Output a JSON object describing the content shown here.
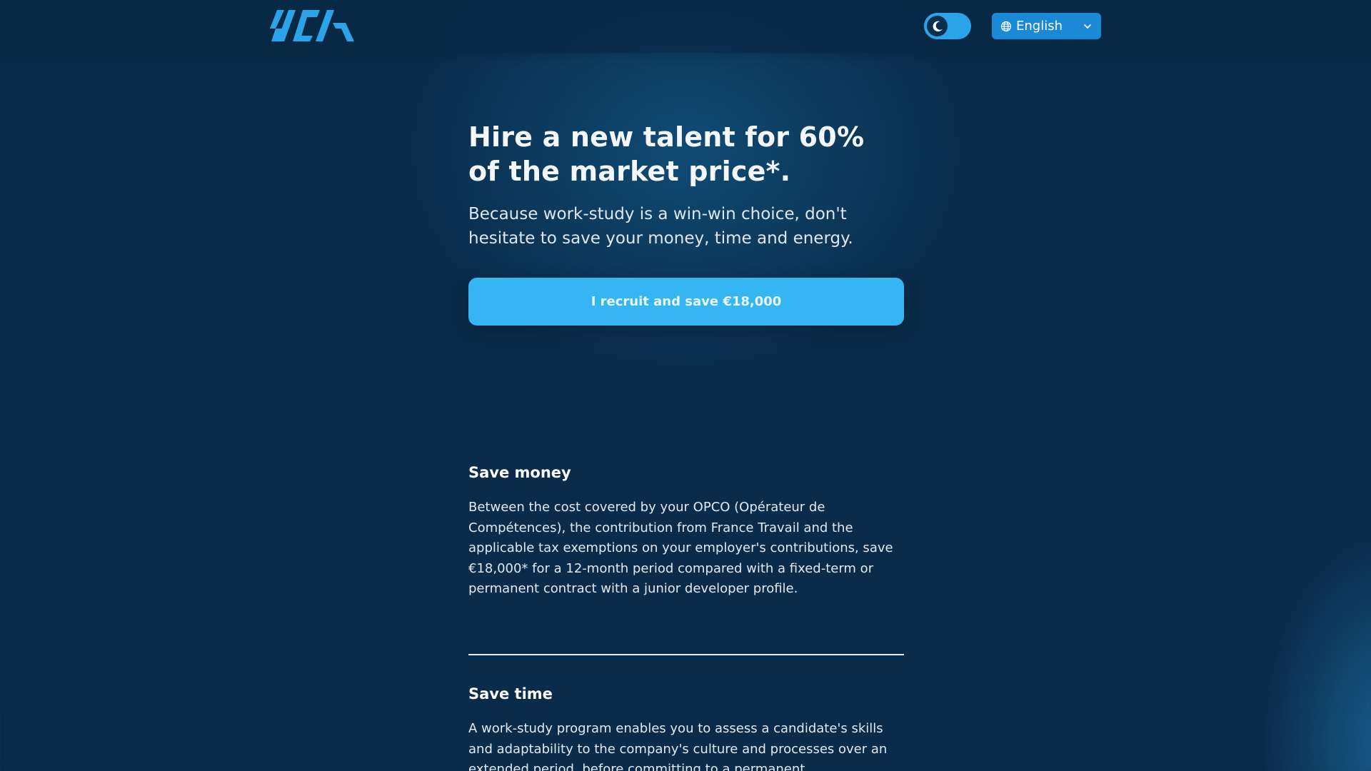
{
  "header": {
    "logo_alt": "ucm",
    "theme_toggle": {
      "mode": "dark",
      "icon": "moon-icon"
    },
    "language": {
      "selected": "English",
      "icon": "globe-icon",
      "chevron": "chevron-down-icon"
    }
  },
  "hero": {
    "title": "Hire a new talent for 60% of the market price*.",
    "subtitle": "Because work-study is a win-win choice, don't hesitate to save your money, time and energy.",
    "cta_label": "I recruit and save €18,000"
  },
  "sections": [
    {
      "title": "Save money",
      "body": "Between the cost covered by your OPCO (Opérateur de Compétences), the contribution from France Travail and the applicable tax exemptions on your employer's contributions, save €18,000* for a 12-month period compared with a fixed-term or permanent contract with a junior developer profile."
    },
    {
      "title": "Save time",
      "body": "A work-study program enables you to assess a candidate's skills and adaptability to the company's culture and processes over an extended period, before committing to a permanent"
    }
  ],
  "colors": {
    "background": "#0a2c4a",
    "accent": "#35b6f3",
    "logo": "#2ba3e8",
    "language_button": "#1a8ad6"
  }
}
